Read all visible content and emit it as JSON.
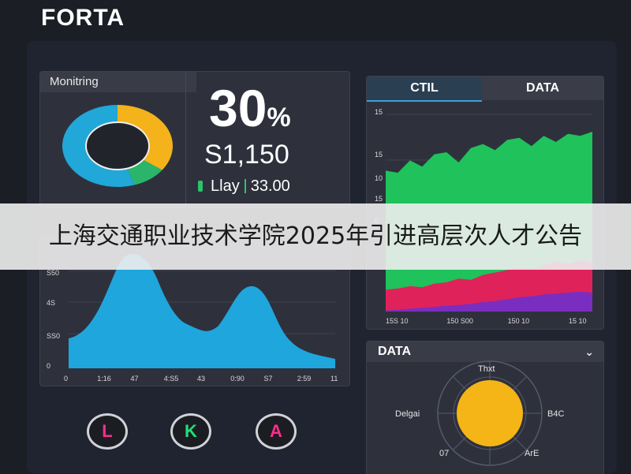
{
  "app": {
    "brand": "FORTA"
  },
  "monitoring": {
    "tab_label": "Monitring",
    "percent": "30",
    "percent_unit": "%",
    "amount": "S1,150",
    "rate_label": "Llay",
    "rate_value": "33.00",
    "donut": [
      {
        "label": "yellow",
        "fraction": 0.35,
        "color": "#f4b21b"
      },
      {
        "label": "green",
        "fraction": 0.1,
        "color": "#2ab56a"
      },
      {
        "label": "blue",
        "fraction": 0.55,
        "color": "#21a7d8"
      }
    ]
  },
  "wave_chart": {
    "y_ticks": [
      "S50",
      "4S",
      "SS0",
      "0"
    ],
    "x_ticks": [
      "0",
      "1:16",
      "47",
      "4:S5",
      "43",
      "0:90",
      "S7",
      "2:59",
      "11"
    ],
    "color": "#1fa6dc"
  },
  "right_chart": {
    "tabs": [
      {
        "label": "CTIL",
        "active": true
      },
      {
        "label": "DATA",
        "active": false
      }
    ],
    "y_ticks": [
      "15",
      "15",
      "10",
      "15",
      "0"
    ],
    "x_ticks": [
      "15S 10",
      "150 S00",
      "150 10",
      "15 10"
    ],
    "green_series": [
      0.62,
      0.6,
      0.72,
      0.66,
      0.78,
      0.8,
      0.7,
      0.84,
      0.88,
      0.82,
      0.92,
      0.94,
      0.86,
      0.96,
      0.9,
      0.98,
      0.96,
      1.0
    ],
    "pink_series": [
      0.38,
      0.4,
      0.44,
      0.42,
      0.48,
      0.5,
      0.56,
      0.54,
      0.62,
      0.66,
      0.7,
      0.74,
      0.72,
      0.78,
      0.84,
      0.8,
      0.86,
      0.82
    ],
    "purple_series": [
      0.22,
      0.24,
      0.26,
      0.28,
      0.3,
      0.32,
      0.34,
      0.36,
      0.4,
      0.42,
      0.46,
      0.5,
      0.52,
      0.56,
      0.58,
      0.6,
      0.62,
      0.6
    ],
    "colors": {
      "green": "#1fc25b",
      "pink": "#e0225a",
      "purple": "#7a2ec0"
    }
  },
  "radial": {
    "title": "DATA",
    "labels": {
      "top": "Thxt",
      "left": "Delgai",
      "right": "B4C",
      "bottom_left": "07",
      "bottom_right": "ArE"
    },
    "center_color": "#f5b516"
  },
  "buttons": [
    {
      "label": "L",
      "color": "#ff2d8a"
    },
    {
      "label": "K",
      "color": "#22e07a"
    },
    {
      "label": "A",
      "color": "#ff2d8a"
    }
  ],
  "banner": {
    "text": "上海交通职业技术学院2025年引进高层次人才公告"
  }
}
